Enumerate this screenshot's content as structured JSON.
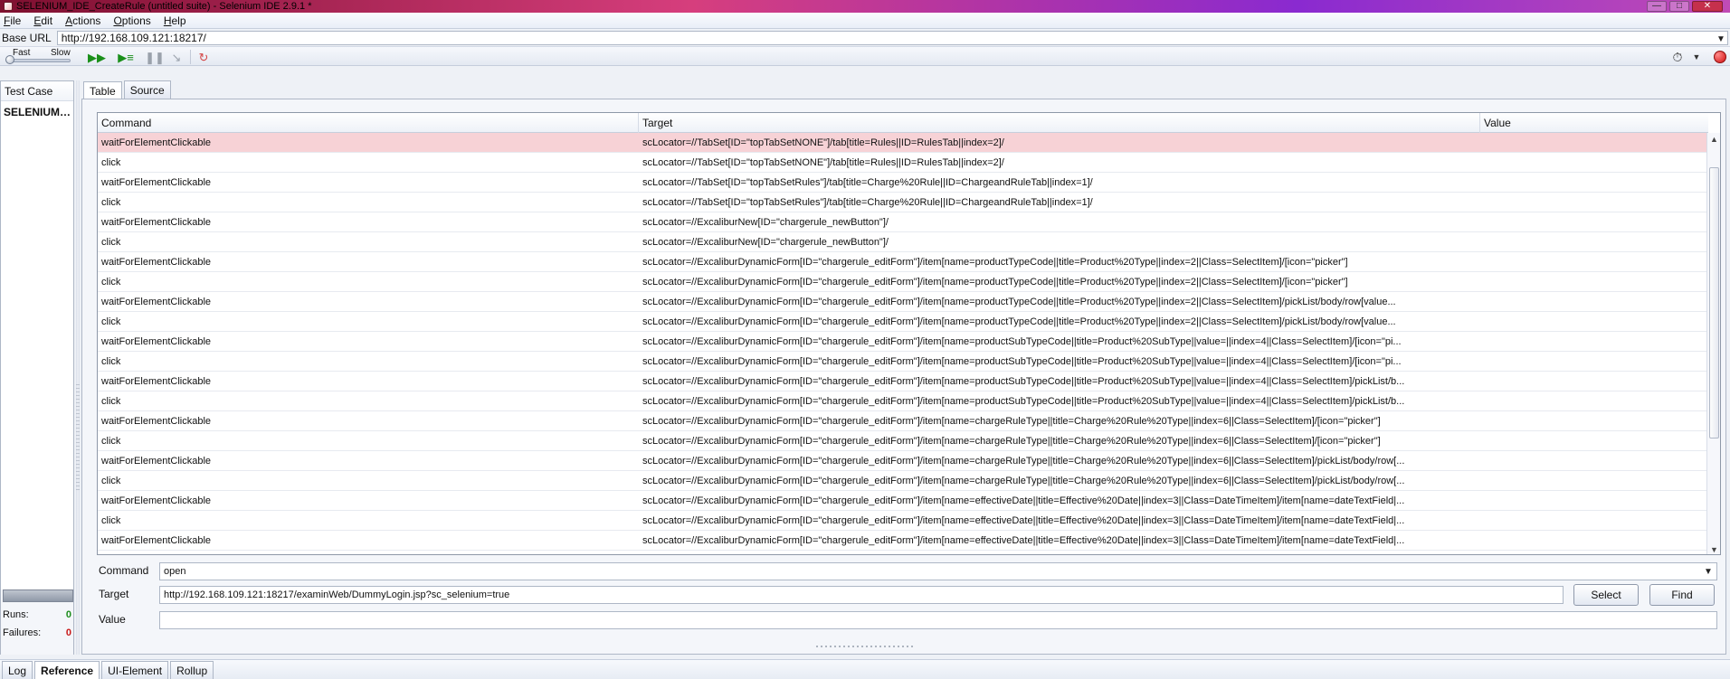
{
  "window": {
    "title": "SELENIUM_IDE_CreateRule (untitled suite) - Selenium IDE 2.9.1 *",
    "controls": {
      "minimize": "—",
      "maximize": "□",
      "close": "✕"
    }
  },
  "menu": {
    "items": [
      {
        "label": "File",
        "mnemonic": "F"
      },
      {
        "label": "Edit",
        "mnemonic": "E"
      },
      {
        "label": "Actions",
        "mnemonic": "A"
      },
      {
        "label": "Options",
        "mnemonic": "O"
      },
      {
        "label": "Help",
        "mnemonic": "H"
      }
    ]
  },
  "base_url": {
    "label": "Base URL",
    "value": "http://192.168.109.121:18217/"
  },
  "toolbar": {
    "speed": {
      "fast_label": "Fast",
      "slow_label": "Slow"
    },
    "icons": {
      "play_suite": "play-suite-icon",
      "play_case": "play-case-icon",
      "pause": "pause-icon",
      "step": "step-icon",
      "rollup": "rollup-icon",
      "schedule": "clock-icon",
      "record": "record-icon"
    }
  },
  "test_case_panel": {
    "header": "Test Case",
    "items": [
      "SELENIUM_..."
    ]
  },
  "tabs": {
    "table": "Table",
    "source": "Source"
  },
  "commands_table": {
    "columns": [
      "Command",
      "Target",
      "Value"
    ],
    "rows": [
      {
        "command": "waitForElementClickable",
        "target": "scLocator=//TabSet[ID=\"topTabSetNONE\"]/tab[title=Rules||ID=RulesTab||index=2]/",
        "value": ""
      },
      {
        "command": "click",
        "target": "scLocator=//TabSet[ID=\"topTabSetNONE\"]/tab[title=Rules||ID=RulesTab||index=2]/",
        "value": ""
      },
      {
        "command": "waitForElementClickable",
        "target": "scLocator=//TabSet[ID=\"topTabSetRules\"]/tab[title=Charge%20Rule||ID=ChargeandRuleTab||index=1]/",
        "value": ""
      },
      {
        "command": "click",
        "target": "scLocator=//TabSet[ID=\"topTabSetRules\"]/tab[title=Charge%20Rule||ID=ChargeandRuleTab||index=1]/",
        "value": ""
      },
      {
        "command": "waitForElementClickable",
        "target": "scLocator=//ExcaliburNew[ID=\"chargerule_newButton\"]/",
        "value": ""
      },
      {
        "command": "click",
        "target": "scLocator=//ExcaliburNew[ID=\"chargerule_newButton\"]/",
        "value": ""
      },
      {
        "command": "waitForElementClickable",
        "target": "scLocator=//ExcaliburDynamicForm[ID=\"chargerule_editForm\"]/item[name=productTypeCode||title=Product%20Type||index=2||Class=SelectItem]/[icon=\"picker\"]",
        "value": ""
      },
      {
        "command": "click",
        "target": "scLocator=//ExcaliburDynamicForm[ID=\"chargerule_editForm\"]/item[name=productTypeCode||title=Product%20Type||index=2||Class=SelectItem]/[icon=\"picker\"]",
        "value": ""
      },
      {
        "command": "waitForElementClickable",
        "target": "scLocator=//ExcaliburDynamicForm[ID=\"chargerule_editForm\"]/item[name=productTypeCode||title=Product%20Type||index=2||Class=SelectItem]/pickList/body/row[value...",
        "value": ""
      },
      {
        "command": "click",
        "target": "scLocator=//ExcaliburDynamicForm[ID=\"chargerule_editForm\"]/item[name=productTypeCode||title=Product%20Type||index=2||Class=SelectItem]/pickList/body/row[value...",
        "value": ""
      },
      {
        "command": "waitForElementClickable",
        "target": "scLocator=//ExcaliburDynamicForm[ID=\"chargerule_editForm\"]/item[name=productSubTypeCode||title=Product%20SubType||value=||index=4||Class=SelectItem]/[icon=\"pi...",
        "value": ""
      },
      {
        "command": "click",
        "target": "scLocator=//ExcaliburDynamicForm[ID=\"chargerule_editForm\"]/item[name=productSubTypeCode||title=Product%20SubType||value=||index=4||Class=SelectItem]/[icon=\"pi...",
        "value": ""
      },
      {
        "command": "waitForElementClickable",
        "target": "scLocator=//ExcaliburDynamicForm[ID=\"chargerule_editForm\"]/item[name=productSubTypeCode||title=Product%20SubType||value=||index=4||Class=SelectItem]/pickList/b...",
        "value": ""
      },
      {
        "command": "click",
        "target": "scLocator=//ExcaliburDynamicForm[ID=\"chargerule_editForm\"]/item[name=productSubTypeCode||title=Product%20SubType||value=||index=4||Class=SelectItem]/pickList/b...",
        "value": ""
      },
      {
        "command": "waitForElementClickable",
        "target": "scLocator=//ExcaliburDynamicForm[ID=\"chargerule_editForm\"]/item[name=chargeRuleType||title=Charge%20Rule%20Type||index=6||Class=SelectItem]/[icon=\"picker\"]",
        "value": ""
      },
      {
        "command": "click",
        "target": "scLocator=//ExcaliburDynamicForm[ID=\"chargerule_editForm\"]/item[name=chargeRuleType||title=Charge%20Rule%20Type||index=6||Class=SelectItem]/[icon=\"picker\"]",
        "value": ""
      },
      {
        "command": "waitForElementClickable",
        "target": "scLocator=//ExcaliburDynamicForm[ID=\"chargerule_editForm\"]/item[name=chargeRuleType||title=Charge%20Rule%20Type||index=6||Class=SelectItem]/pickList/body/row[...",
        "value": ""
      },
      {
        "command": "click",
        "target": "scLocator=//ExcaliburDynamicForm[ID=\"chargerule_editForm\"]/item[name=chargeRuleType||title=Charge%20Rule%20Type||index=6||Class=SelectItem]/pickList/body/row[...",
        "value": ""
      },
      {
        "command": "waitForElementClickable",
        "target": "scLocator=//ExcaliburDynamicForm[ID=\"chargerule_editForm\"]/item[name=effectiveDate||title=Effective%20Date||index=3||Class=DateTimeItem]/item[name=dateTextField|...",
        "value": ""
      },
      {
        "command": "click",
        "target": "scLocator=//ExcaliburDynamicForm[ID=\"chargerule_editForm\"]/item[name=effectiveDate||title=Effective%20Date||index=3||Class=DateTimeItem]/item[name=dateTextField|...",
        "value": ""
      },
      {
        "command": "waitForElementClickable",
        "target": "scLocator=//ExcaliburDynamicForm[ID=\"chargerule_editForm\"]/item[name=effectiveDate||title=Effective%20Date||index=3||Class=DateTimeItem]/item[name=dateTextField|...",
        "value": ""
      }
    ],
    "selected_row_index": 0
  },
  "command_editor": {
    "command_label": "Command",
    "command_value": "open",
    "target_label": "Target",
    "target_value": "http://192.168.109.121:18217/examinWeb/DummyLogin.jsp?sc_selenium=true",
    "value_label": "Value",
    "value_value": "",
    "select_button": "Select",
    "find_button": "Find"
  },
  "runs_panel": {
    "runs_label": "Runs:",
    "runs_value": "0",
    "failures_label": "Failures:",
    "failures_value": "0"
  },
  "bottom_tabs": [
    {
      "label": "Log"
    },
    {
      "label": "Reference"
    },
    {
      "label": "UI-Element"
    },
    {
      "label": "Rollup"
    }
  ],
  "bottom_tabs_active_index": 1
}
